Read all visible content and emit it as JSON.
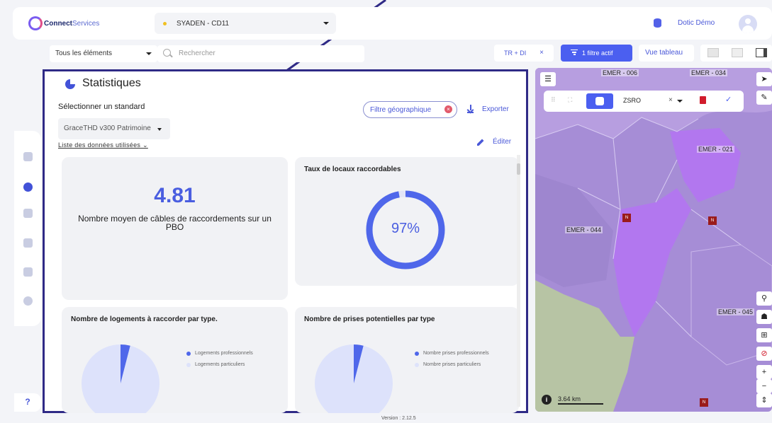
{
  "header": {
    "logo_text_bold": "Connect",
    "logo_text_light": "Services",
    "site": "SYADEN - CD11",
    "user_name": "Dotic Démo"
  },
  "toolbar": {
    "elements_select": "Tous les éléments",
    "search_placeholder": "Rechercher",
    "filter_chip": "TR + DI",
    "filter_chip_close": "×",
    "filter_button": "1 filtre actif",
    "table_view_button": "Vue tableau"
  },
  "stats": {
    "title": "Statistiques",
    "standard_label": "Sélectionner un standard",
    "standard_value": "GraceTHD v300 Patrimoine",
    "data_link": "Liste des données utilisées ⌄",
    "geo_filter": "Filtre géographique",
    "geo_filter_close": "×",
    "export": "Exporter",
    "edit": "Éditer",
    "cards": {
      "avg_cables": {
        "value": "4.81",
        "label": "Nombre moyen de câbles de raccordements sur un PBO"
      },
      "connectable_rate": {
        "title": "Taux de locaux raccordables",
        "value": "97%",
        "fraction": 0.97
      },
      "housing_by_type": {
        "title": "Nombre de logements à raccorder par type.",
        "legend": [
          "Logements professionnels",
          "Logements particuliers"
        ],
        "pro_share": 0.04
      },
      "potential_plugs": {
        "title": "Nombre de prises potentielles par type",
        "legend": [
          "Nombre prises professionnels",
          "Nombre prises particuliers"
        ],
        "pro_share": 0.04
      }
    }
  },
  "map": {
    "labels": [
      "EMER - 006",
      "EMER - 034",
      "EMER - 021",
      "EMER - 044",
      "EMER - 045"
    ],
    "layer": "ZSRO",
    "layer_clear": "×",
    "marker": "N",
    "scale": "3.64 km",
    "info": "i"
  },
  "help": "?",
  "version": "Version : 2.12.5",
  "colors": {
    "accent": "#4b5ff0",
    "panel_border": "#2f2a86",
    "zone": "#a77ae6",
    "zone_highlight": "#b069f0",
    "marker": "#9a1b1b"
  }
}
